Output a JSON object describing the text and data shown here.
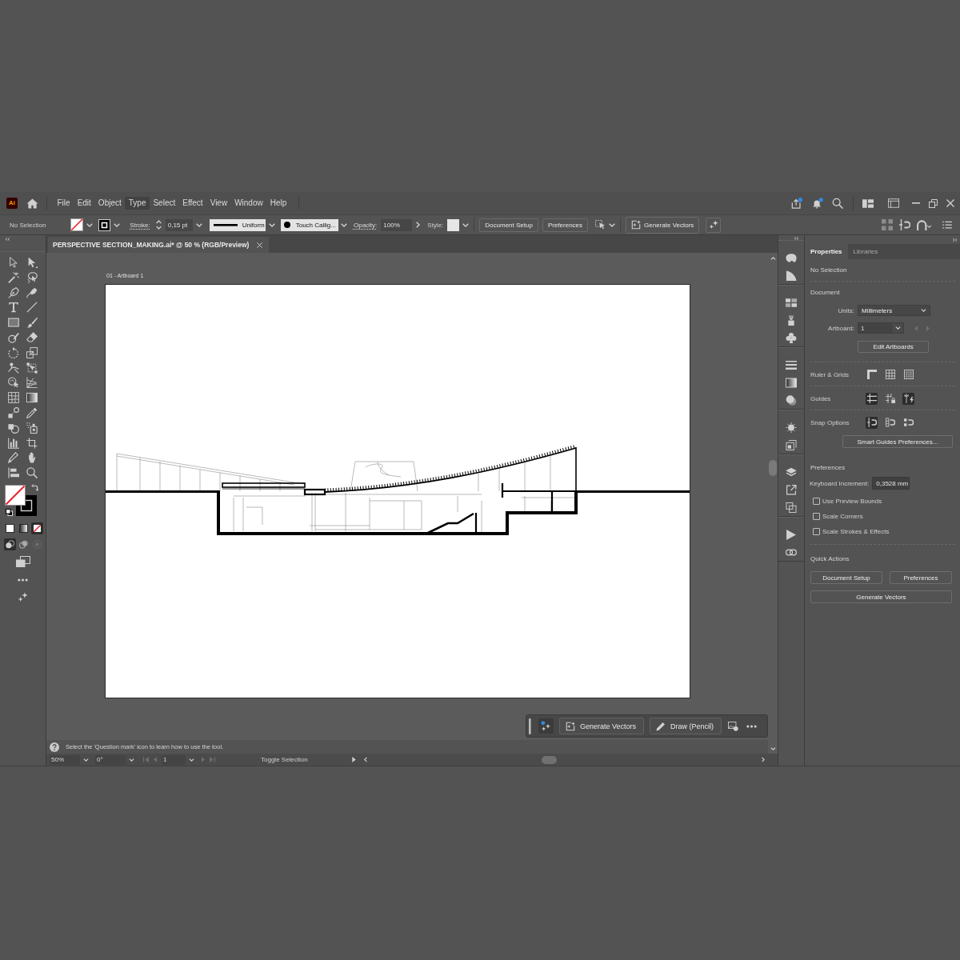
{
  "app": {
    "logo": "Ai"
  },
  "menu": [
    {
      "label": "File",
      "selected": false
    },
    {
      "label": "Edit",
      "selected": false
    },
    {
      "label": "Object",
      "selected": false
    },
    {
      "label": "Type",
      "selected": true
    },
    {
      "label": "Select",
      "selected": false
    },
    {
      "label": "Effect",
      "selected": false
    },
    {
      "label": "View",
      "selected": false
    },
    {
      "label": "Window",
      "selected": false
    },
    {
      "label": "Help",
      "selected": false
    }
  ],
  "control_bar": {
    "selection": "No Selection",
    "stroke_label": "Stroke:",
    "stroke_weight": "0,15 pt",
    "stroke_profile": "Uniform",
    "brush": "Touch Callig...",
    "opacity_label": "Opacity:",
    "opacity": "100%",
    "style_label": "Style:",
    "buttons": [
      "Document Setup",
      "Preferences"
    ],
    "generate_button": "Generate Vectors"
  },
  "document_tab": {
    "title": "PERSPECTIVE SECTION_MAKING.ai* @ 50 % (RGB/Preview)"
  },
  "toolbar": {
    "color_modes": [
      {
        "kind": "color",
        "selected": false
      },
      {
        "kind": "gradient",
        "selected": false
      },
      {
        "kind": "none",
        "selected": true
      }
    ],
    "draw_modes": [
      {
        "kind": "normal",
        "selected": true,
        "disabled": false
      },
      {
        "kind": "behind",
        "selected": false,
        "disabled": false
      },
      {
        "kind": "inside",
        "selected": false,
        "disabled": true
      }
    ]
  },
  "artboard": {
    "label": "01 - Artboard 1"
  },
  "task_bar": {
    "buttons": [
      {
        "kind": "generate",
        "label": "Generate Vectors"
      },
      {
        "kind": "draw",
        "label": "Draw (Pencil)"
      }
    ]
  },
  "hint": "Select the 'Question mark' icon to learn how to use the tool.",
  "status_bar": {
    "zoom": "50%",
    "rotation": "0°",
    "artboard": "1",
    "info": "Toggle Selection"
  },
  "properties": {
    "tabs": [
      {
        "label": "Properties",
        "selected": true
      },
      {
        "label": "Libraries",
        "selected": false
      }
    ],
    "selection": "No Selection",
    "document": {
      "title": "Document",
      "units_label": "Units:",
      "units": "Millimeters",
      "artboard_label": "Artboard:",
      "artboard": "1",
      "edit_button": "Edit Artboards"
    },
    "toggle_rows": [
      {
        "label": "Ruler & Grids",
        "icons": [
          {
            "kind": "ruler",
            "on": false
          },
          {
            "kind": "grid",
            "on": false
          },
          {
            "kind": "pixel-grid",
            "on": false
          }
        ]
      },
      {
        "label": "Guides",
        "icons": [
          {
            "kind": "guides",
            "on": true
          },
          {
            "kind": "lock-guides",
            "on": false
          },
          {
            "kind": "smart-guides",
            "on": true
          }
        ]
      },
      {
        "label": "Snap Options",
        "icons": [
          {
            "kind": "snap-point",
            "on": true
          },
          {
            "kind": "snap-grid",
            "on": false
          },
          {
            "kind": "snap-pixel",
            "on": false
          }
        ]
      }
    ],
    "smart_guides_button": "Smart Guides Preferences...",
    "preferences": {
      "title": "Preferences",
      "increment_label": "Keyboard Increment:",
      "increment": "0,3528 mm",
      "checkboxes": [
        {
          "label": "Use Preview Bounds",
          "checked": false
        },
        {
          "label": "Scale Corners",
          "checked": false
        },
        {
          "label": "Scale Strokes & Effects",
          "checked": false
        }
      ]
    },
    "quick_actions": {
      "title": "Quick Actions",
      "buttons": [
        "Document Setup",
        "Preferences",
        "Generate Vectors"
      ]
    }
  }
}
